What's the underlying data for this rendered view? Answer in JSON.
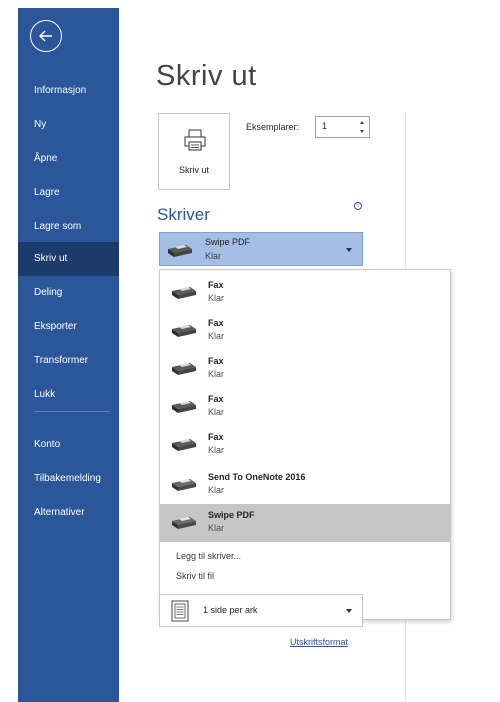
{
  "sidebar": {
    "items": [
      {
        "label": "Informasjon"
      },
      {
        "label": "Ny"
      },
      {
        "label": "Åpne"
      },
      {
        "label": "Lagre"
      },
      {
        "label": "Lagre som"
      },
      {
        "label": "Skriv ut",
        "active": true
      },
      {
        "label": "Deling"
      },
      {
        "label": "Eksporter"
      },
      {
        "label": "Transformer"
      },
      {
        "label": "Lukk"
      }
    ],
    "bottom_items": [
      {
        "label": "Konto"
      },
      {
        "label": "Tilbakemelding"
      },
      {
        "label": "Alternativer"
      }
    ]
  },
  "main": {
    "title": "Skriv ut",
    "print_button_label": "Skriv ut",
    "copies_label": "Eksemplarer:",
    "copies_value": "1",
    "printer_section_title": "Skriver",
    "info_icon_glyph": "i",
    "selected_printer": {
      "name": "Swipe PDF",
      "status": "Klar"
    },
    "printer_list": [
      {
        "name": "Fax",
        "status": "Klar"
      },
      {
        "name": "Fax",
        "status": "Klar"
      },
      {
        "name": "Fax",
        "status": "Klar"
      },
      {
        "name": "Fax",
        "status": "Klar"
      },
      {
        "name": "Fax",
        "status": "Klar"
      },
      {
        "name": "Send To OneNote 2016",
        "status": "Klar"
      },
      {
        "name": "Swipe PDF",
        "status": "Klar",
        "selected": true
      }
    ],
    "add_printer_label": "Legg til skriver...",
    "print_to_file_label": "Skriv til fil",
    "pages_per_sheet": "1 side per ark",
    "page_setup_link": "Utskriftsformat"
  },
  "colors": {
    "accent": "#2b579a",
    "sidebar_active": "#1c3a6c",
    "selected_printer_bg": "#a5bee5",
    "list_selected_bg": "#c6c6c6"
  },
  "icons": [
    "back-arrow-icon",
    "printer-icon",
    "fax-printer-icon",
    "info-icon",
    "chevron-down-icon",
    "page-layout-icon",
    "spin-arrows-icon"
  ]
}
